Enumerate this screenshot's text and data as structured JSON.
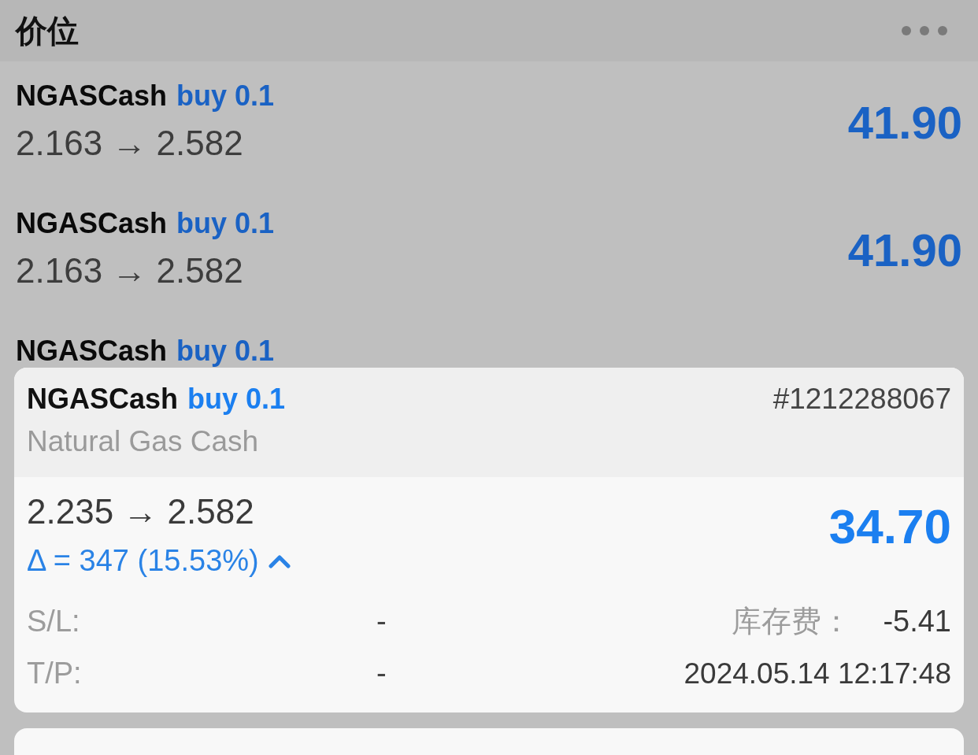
{
  "header": {
    "title": "价位"
  },
  "positions": [
    {
      "symbol": "NGASCash",
      "order": "buy 0.1",
      "prices": "2.163 → 2.582",
      "profit": "41.90"
    },
    {
      "symbol": "NGASCash",
      "order": "buy 0.1",
      "prices": "2.163 → 2.582",
      "profit": "41.90"
    },
    {
      "symbol": "NGASCash",
      "order": "buy 0.1"
    }
  ],
  "detail": {
    "symbol": "NGASCash",
    "order": "buy 0.1",
    "ticket": "#1212288067",
    "description": "Natural Gas Cash",
    "prices": "2.235 → 2.582",
    "change": "Δ = 347 (15.53%)",
    "rising": true,
    "profit": "34.70",
    "stop_loss": {
      "label": "S/L:",
      "value": "-"
    },
    "take_profit": {
      "label": "T/P:",
      "value": "-"
    },
    "swap": {
      "label": "库存费：",
      "value": "-5.41"
    },
    "open_time": "2024.05.14 12:17:48"
  }
}
